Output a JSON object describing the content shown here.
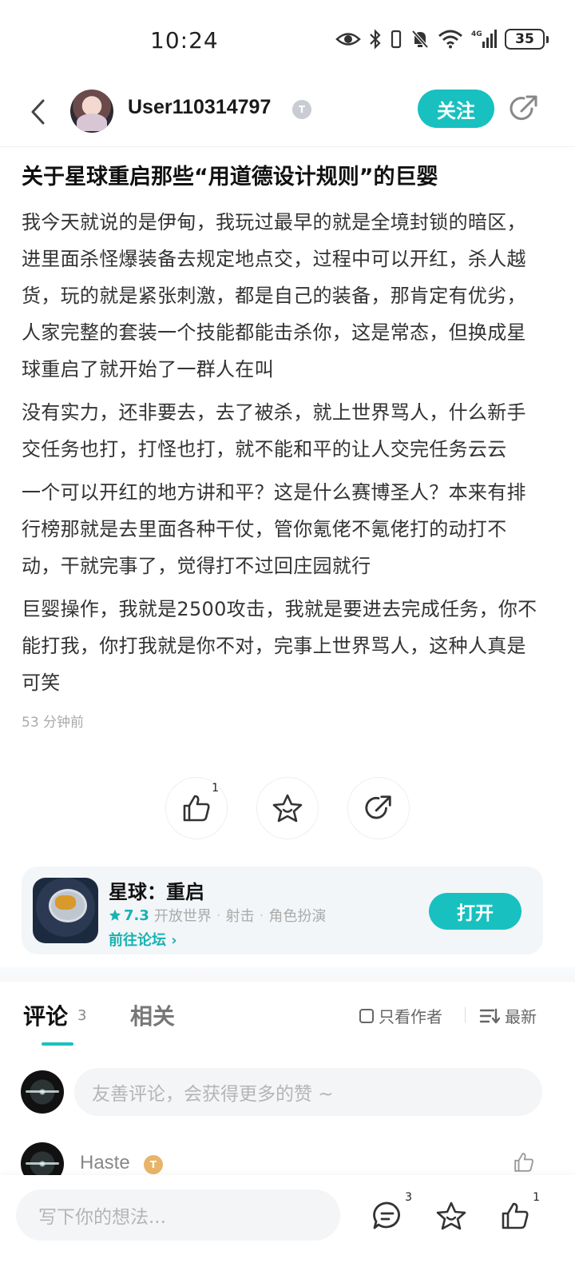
{
  "status_bar": {
    "time": "10:24",
    "battery": "35"
  },
  "header": {
    "username": "User110314797",
    "level_badge": "T",
    "follow_label": "关注"
  },
  "post": {
    "title": "关于星球重启那些“用道德设计规则”的巨婴",
    "paragraphs": [
      "我今天就说的是伊甸，我玩过最早的就是全境封锁的暗区，进里面杀怪爆装备去规定地点交，过程中可以开红，杀人越货，玩的就是紧张刺激，都是自己的装备，那肯定有优劣，人家完整的套装一个技能都能击杀你，这是常态，但换成星球重启了就开始了一群人在叫",
      "没有实力，还非要去，去了被杀，就上世界骂人，什么新手交任务也打，打怪也打，就不能和平的让人交完任务云云",
      "一个可以开红的地方讲和平？这是什么赛博圣人？本来有排行榜那就是去里面各种干仗，管你氪佬不氪佬打的动打不动，干就完事了，觉得打不过回庄园就行",
      "巨婴操作，我就是2500攻击，我就是要进去完成任务，你不能打我，你打我就是你不对，完事上世界骂人，这种人真是可笑"
    ],
    "timestamp": "53 分钟前"
  },
  "actions": {
    "like_count": "1"
  },
  "game_card": {
    "name": "星球：重启",
    "rating": "7.3",
    "tags": [
      "开放世界",
      "射击",
      "角色扮演"
    ],
    "forum_link": "前往论坛 ›",
    "open_label": "打开"
  },
  "comments": {
    "tab_label": "评论",
    "count": "3",
    "related_label": "相关",
    "author_only_label": "只看作者",
    "sort_label": "最新",
    "input_placeholder": "友善评论，会获得更多的赞 ~",
    "first_commenter": "Haste",
    "first_commenter_badge": "T"
  },
  "bottom_bar": {
    "placeholder": "写下你的想法...",
    "comment_count": "3",
    "like_count": "1"
  },
  "colors": {
    "accent": "#18c0c0"
  }
}
